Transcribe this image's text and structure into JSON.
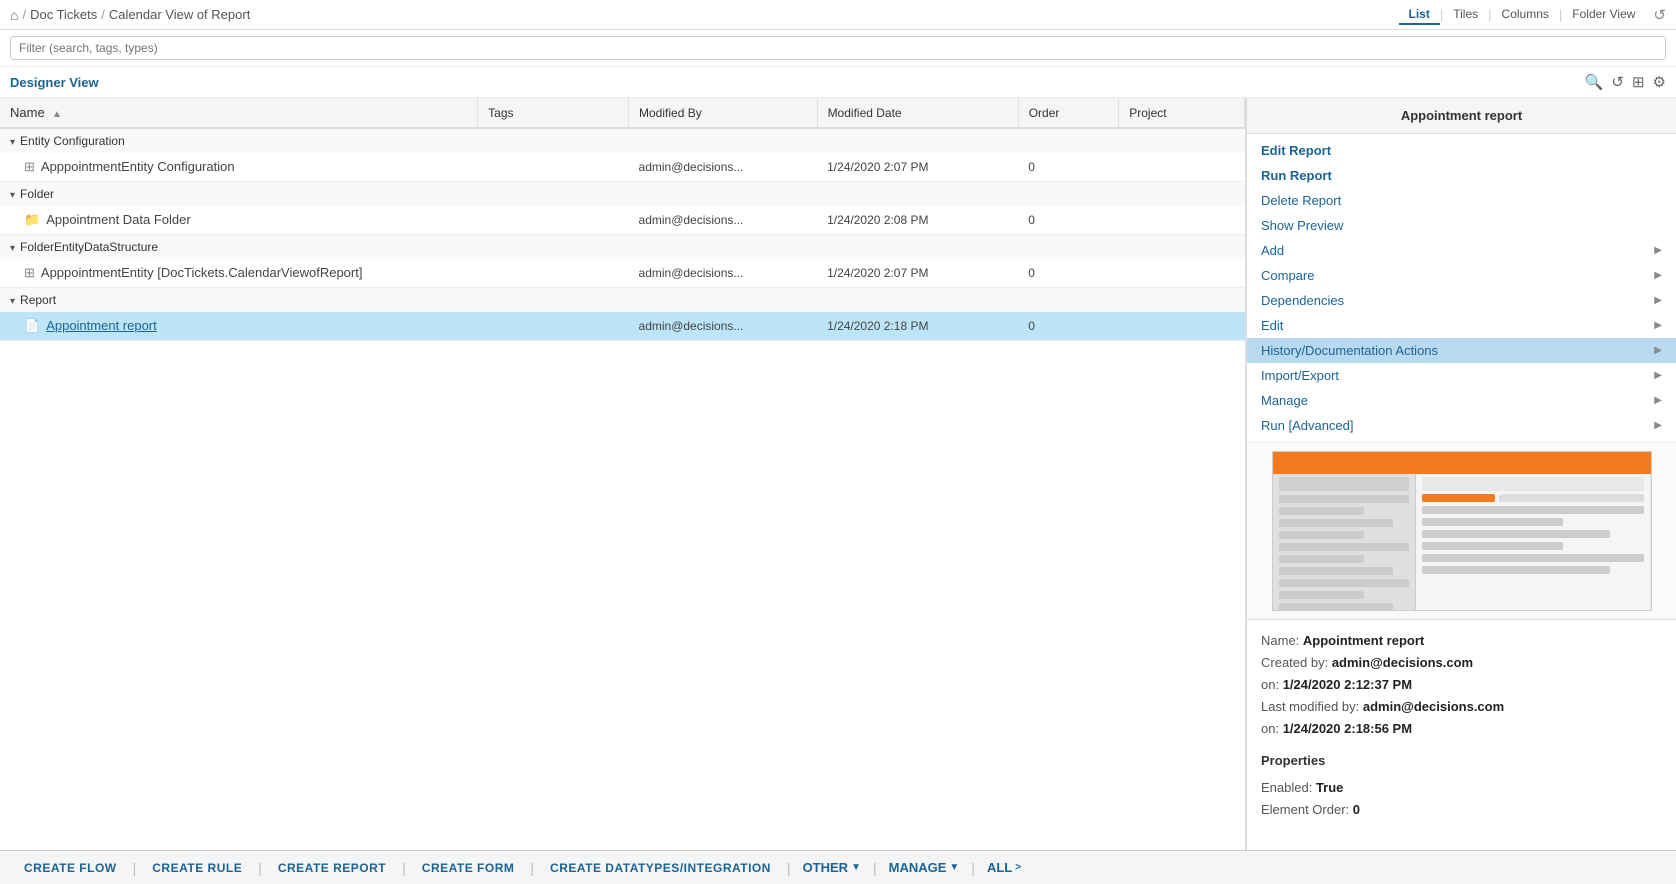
{
  "topNav": {
    "breadcrumb": [
      "Home",
      "Doc Tickets",
      "Calendar View of Report"
    ],
    "viewTabs": [
      "List",
      "Tiles",
      "Columns",
      "Folder View"
    ],
    "activeTab": "List"
  },
  "filterBar": {
    "placeholder": "Filter (search, tags, types)"
  },
  "designerView": {
    "title": "Designer View"
  },
  "table": {
    "columns": [
      "Name",
      "Tags",
      "Modified By",
      "Modified Date",
      "Order",
      "Project"
    ],
    "groups": [
      {
        "name": "Entity Configuration",
        "rows": [
          {
            "icon": "entity-icon",
            "name": "ApppointmentEntity Configuration",
            "tags": "",
            "modifiedBy": "admin@decisions...",
            "modifiedDate": "1/24/2020 2:07 PM",
            "order": "0",
            "project": ""
          }
        ]
      },
      {
        "name": "Folder",
        "rows": [
          {
            "icon": "folder-icon",
            "name": "Appointment Data Folder",
            "tags": "",
            "modifiedBy": "admin@decisions...",
            "modifiedDate": "1/24/2020 2:08 PM",
            "order": "0",
            "project": ""
          }
        ]
      },
      {
        "name": "FolderEntityDataStructure",
        "rows": [
          {
            "icon": "entity-icon",
            "name": "ApppointmentEntity [DocTickets.CalendarViewofReport]",
            "tags": "",
            "modifiedBy": "admin@decisions...",
            "modifiedDate": "1/24/2020 2:07 PM",
            "order": "0",
            "project": ""
          }
        ]
      },
      {
        "name": "Report",
        "rows": [
          {
            "icon": "report-icon",
            "name": "Appointment report",
            "tags": "",
            "modifiedBy": "admin@decisions...",
            "modifiedDate": "1/24/2020 2:18 PM",
            "order": "0",
            "project": "",
            "selected": true,
            "isLink": true
          }
        ]
      }
    ]
  },
  "rightPanel": {
    "title": "Appointment report",
    "actions": [
      {
        "label": "Edit Report",
        "hasChevron": false,
        "bold": true,
        "highlighted": false
      },
      {
        "label": "Run Report",
        "hasChevron": false,
        "bold": true,
        "highlighted": false
      },
      {
        "label": "Delete Report",
        "hasChevron": false,
        "bold": false,
        "highlighted": false
      },
      {
        "label": "Show Preview",
        "hasChevron": false,
        "bold": false,
        "highlighted": false
      },
      {
        "label": "Add",
        "hasChevron": true,
        "bold": false,
        "highlighted": false
      },
      {
        "label": "Compare",
        "hasChevron": true,
        "bold": false,
        "highlighted": false
      },
      {
        "label": "Dependencies",
        "hasChevron": true,
        "bold": false,
        "highlighted": false
      },
      {
        "label": "Edit",
        "hasChevron": true,
        "bold": false,
        "highlighted": false
      },
      {
        "label": "History/Documentation Actions",
        "hasChevron": true,
        "bold": false,
        "highlighted": true
      },
      {
        "label": "Import/Export",
        "hasChevron": true,
        "bold": false,
        "highlighted": false
      },
      {
        "label": "Manage",
        "hasChevron": true,
        "bold": false,
        "highlighted": false
      },
      {
        "label": "Run [Advanced]",
        "hasChevron": true,
        "bold": false,
        "highlighted": false
      }
    ],
    "info": {
      "nameLabel": "Name:",
      "nameValue": "Appointment report",
      "createdByLabel": "Created by:",
      "createdByValue": "admin@decisions.com",
      "onLabel1": "on:",
      "onValue1": "1/24/2020 2:12:37 PM",
      "lastModifiedLabel": "Last modified by:",
      "lastModifiedValue": "admin@decisions.com",
      "onLabel2": "on:",
      "onValue2": "1/24/2020 2:18:56 PM",
      "propertiesTitle": "Properties",
      "enabledLabel": "Enabled:",
      "enabledValue": "True",
      "elementOrderLabel": "Element Order:",
      "elementOrderValue": "0"
    }
  },
  "bottomBar": {
    "buttons": [
      "CREATE FLOW",
      "CREATE RULE",
      "CREATE REPORT",
      "CREATE FORM",
      "CREATE DATATYPES/INTEGRATION"
    ],
    "dropdowns": [
      "Other",
      "Manage",
      "All"
    ]
  }
}
